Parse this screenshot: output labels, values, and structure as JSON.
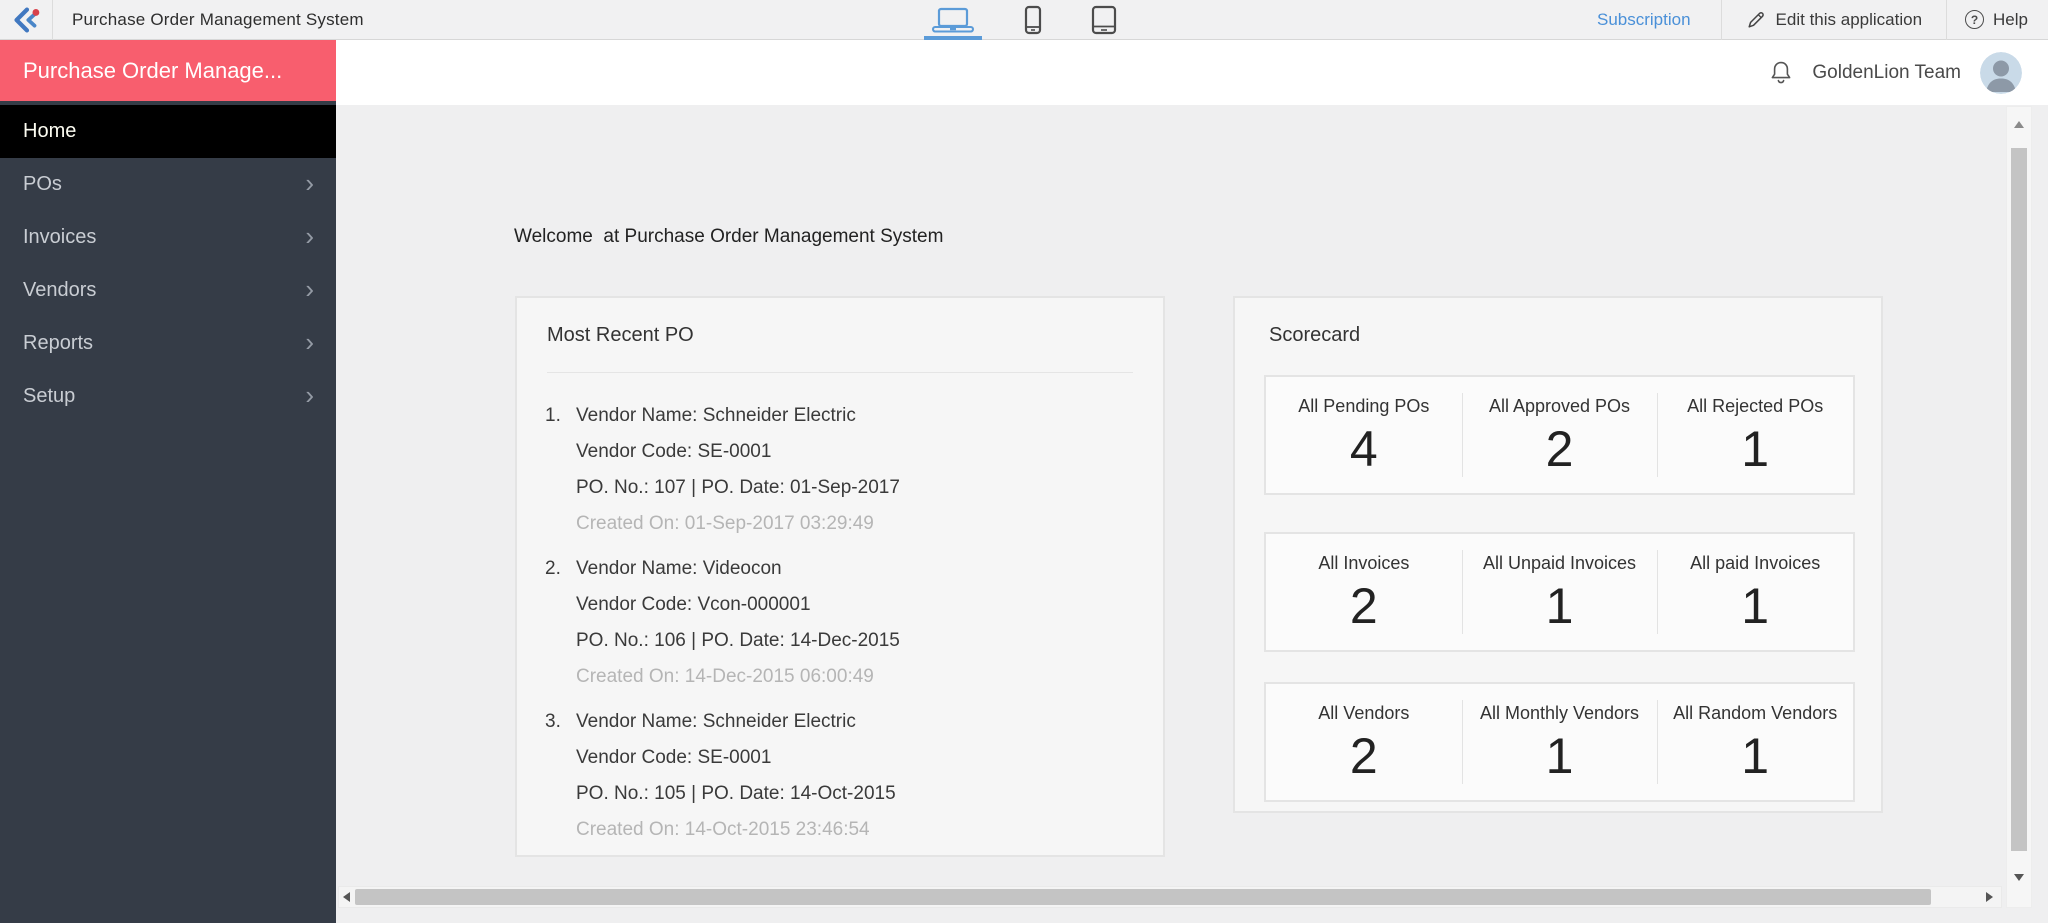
{
  "topbar": {
    "app_title": "Purchase Order Management System",
    "subscription_label": "Subscription",
    "edit_application_label": "Edit this application",
    "help_label": "Help",
    "active_device": "laptop"
  },
  "userbar": {
    "team_name": "GoldenLion Team"
  },
  "sidebar": {
    "app_name": "Purchase Order Manage...",
    "items": [
      {
        "label": "Home",
        "active": true,
        "expandable": false
      },
      {
        "label": "POs",
        "active": false,
        "expandable": true
      },
      {
        "label": "Invoices",
        "active": false,
        "expandable": true
      },
      {
        "label": "Vendors",
        "active": false,
        "expandable": true
      },
      {
        "label": "Reports",
        "active": false,
        "expandable": true
      },
      {
        "label": "Setup",
        "active": false,
        "expandable": true
      }
    ]
  },
  "main": {
    "welcome_text": "Welcome  at Purchase Order Management System",
    "most_recent_po": {
      "title": "Most Recent PO",
      "entries": [
        {
          "number": "1.",
          "vendor_name": "Vendor Name: Schneider Electric",
          "vendor_code": "Vendor Code: SE-0001",
          "po_line": "PO. No.: 107 | PO. Date: 01-Sep-2017",
          "created_on": "Created On: 01-Sep-2017 03:29:49"
        },
        {
          "number": "2.",
          "vendor_name": "Vendor Name: Videocon",
          "vendor_code": "Vendor Code: Vcon-000001",
          "po_line": "PO. No.: 106 | PO. Date: 14-Dec-2015",
          "created_on": "Created On: 14-Dec-2015 06:00:49"
        },
        {
          "number": "3.",
          "vendor_name": "Vendor Name: Schneider Electric",
          "vendor_code": "Vendor Code: SE-0001",
          "po_line": "PO. No.: 105 | PO. Date: 14-Oct-2015",
          "created_on": "Created On: 14-Oct-2015 23:46:54"
        }
      ]
    },
    "scorecard": {
      "title": "Scorecard",
      "rows": [
        {
          "cells": [
            {
              "label": "All Pending POs",
              "value": "4"
            },
            {
              "label": "All Approved POs",
              "value": "2"
            },
            {
              "label": "All Rejected POs",
              "value": "1"
            }
          ]
        },
        {
          "cells": [
            {
              "label": "All Invoices",
              "value": "2"
            },
            {
              "label": "All Unpaid Invoices",
              "value": "1"
            },
            {
              "label": "All paid Invoices",
              "value": "1"
            }
          ]
        },
        {
          "cells": [
            {
              "label": "All Vendors",
              "value": "2"
            },
            {
              "label": "All Monthly Vendors",
              "value": "1"
            },
            {
              "label": "All Random Vendors",
              "value": "1"
            }
          ]
        }
      ]
    }
  },
  "glyphs": {
    "question": "?",
    "chevron": "›"
  },
  "colors": {
    "brand_pink": "#f85e6e",
    "sidebar_bg": "#353c47",
    "active_item_bg": "#000000",
    "accent_blue": "#4a90d8",
    "topbar_bg": "#f1f1f2",
    "content_bg": "#efeff0",
    "card_bg": "#f6f6f6",
    "card_border": "#e4e4e4",
    "muted_text": "#b5b5b5",
    "logo_red": "#d8414b"
  }
}
